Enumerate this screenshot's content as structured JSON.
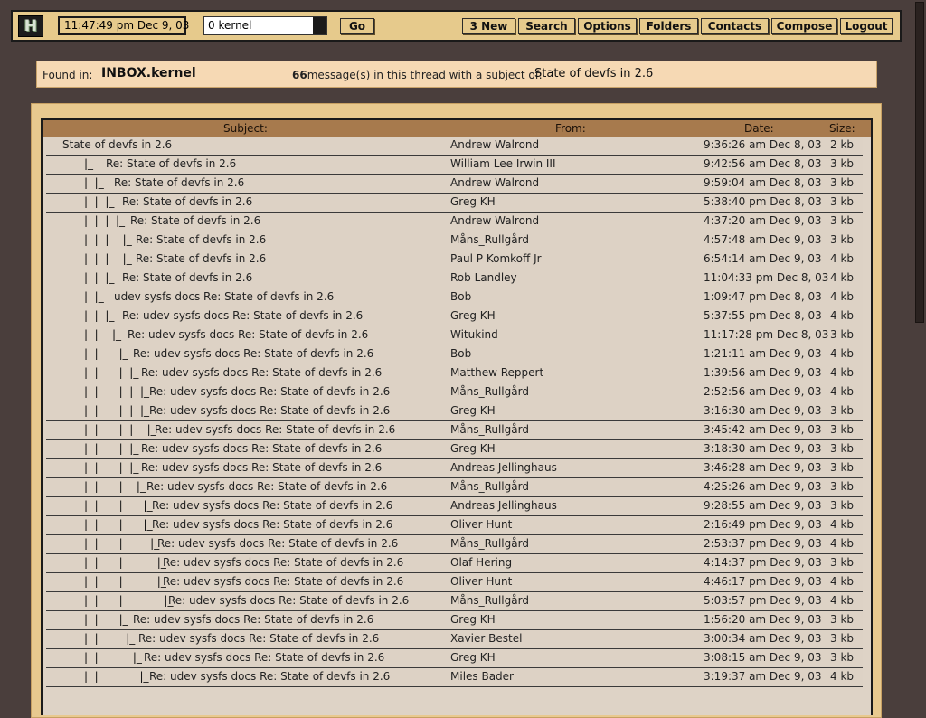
{
  "toolbar": {
    "logo": "H",
    "clock": "11:47:49 pm Dec 9, 03",
    "folder_value": "0 kernel",
    "go_label": "Go",
    "buttons": {
      "new": "3 New",
      "search": "Search",
      "options": "Options",
      "folders": "Folders",
      "contacts": "Contacts",
      "compose": "Compose",
      "logout": "Logout"
    }
  },
  "infobar": {
    "found_label": "Found in:",
    "folder": "INBOX.kernel",
    "count": "66",
    "count_text": "message(s) in this thread with a subject of:",
    "subject": "State of devfs in 2.6"
  },
  "list": {
    "headers": {
      "subject": "Subject:",
      "from": "From:",
      "date": "Date:",
      "size": "Size:"
    },
    "rows": [
      {
        "tree": "",
        "subject": "State of devfs in 2.6",
        "from": "Andrew Walrond",
        "date": "9:36:26 am Dec 8, 03",
        "size": "2 kb"
      },
      {
        "tree": "|_",
        "subject": "Re: State of devfs in 2.6",
        "from": "William Lee Irwin III",
        "date": "9:42:56 am Dec 8, 03",
        "size": "3 kb"
      },
      {
        "tree": "|  |_",
        "subject": "Re: State of devfs in 2.6",
        "from": "Andrew Walrond",
        "date": "9:59:04 am Dec 8, 03",
        "size": "3 kb"
      },
      {
        "tree": "|  |  |_",
        "subject": "Re: State of devfs in 2.6",
        "from": "Greg KH",
        "date": "5:38:40 pm Dec 8, 03",
        "size": "3 kb"
      },
      {
        "tree": "|  |  |  |_",
        "subject": "Re: State of devfs in 2.6",
        "from": "Andrew Walrond",
        "date": "4:37:20 am Dec 9, 03",
        "size": "3 kb"
      },
      {
        "tree": "|  |  |    |_",
        "subject": "Re: State of devfs in 2.6",
        "from": "Måns_Rullgård",
        "date": "4:57:48 am Dec 9, 03",
        "size": "3 kb"
      },
      {
        "tree": "|  |  |    |_",
        "subject": "Re: State of devfs in 2.6",
        "from": "Paul P Komkoff Jr",
        "date": "6:54:14 am Dec 9, 03",
        "size": "4 kb"
      },
      {
        "tree": "|  |  |_",
        "subject": "Re: State of devfs in 2.6",
        "from": "Rob Landley",
        "date": "11:04:33 pm Dec 8, 03",
        "size": "4 kb"
      },
      {
        "tree": "|  |_",
        "subject": "udev sysfs docs Re: State of devfs in 2.6",
        "from": "Bob",
        "date": "1:09:47 pm Dec 8, 03",
        "size": "4 kb"
      },
      {
        "tree": "|  |  |_",
        "subject": "Re: udev sysfs docs Re: State of devfs in 2.6",
        "from": "Greg KH",
        "date": "5:37:55 pm Dec 8, 03",
        "size": "4 kb"
      },
      {
        "tree": "|  |    |_",
        "subject": "Re: udev sysfs docs Re: State of devfs in 2.6",
        "from": "Witukind",
        "date": "11:17:28 pm Dec 8, 03",
        "size": "3 kb"
      },
      {
        "tree": "|  |      |_",
        "subject": "Re: udev sysfs docs Re: State of devfs in 2.6",
        "from": "Bob",
        "date": "1:21:11 am Dec 9, 03",
        "size": "4 kb"
      },
      {
        "tree": "|  |      |  |_",
        "subject": "Re: udev sysfs docs Re: State of devfs in 2.6",
        "from": "Matthew Reppert",
        "date": "1:39:56 am Dec 9, 03",
        "size": "4 kb"
      },
      {
        "tree": "|  |      |  |  |_",
        "subject": "Re: udev sysfs docs Re: State of devfs in 2.6",
        "from": "Måns_Rullgård",
        "date": "2:52:56 am Dec 9, 03",
        "size": "4 kb"
      },
      {
        "tree": "|  |      |  |  |_",
        "subject": "Re: udev sysfs docs Re: State of devfs in 2.6",
        "from": "Greg KH",
        "date": "3:16:30 am Dec 9, 03",
        "size": "3 kb"
      },
      {
        "tree": "|  |      |  |    |_",
        "subject": "Re: udev sysfs docs Re: State of devfs in 2.6",
        "from": "Måns_Rullgård",
        "date": "3:45:42 am Dec 9, 03",
        "size": "3 kb"
      },
      {
        "tree": "|  |      |  |_",
        "subject": "Re: udev sysfs docs Re: State of devfs in 2.6",
        "from": "Greg KH",
        "date": "3:18:30 am Dec 9, 03",
        "size": "3 kb"
      },
      {
        "tree": "|  |      |  |_",
        "subject": "Re: udev sysfs docs Re: State of devfs in 2.6",
        "from": "Andreas Jellinghaus",
        "date": "3:46:28 am Dec 9, 03",
        "size": "3 kb"
      },
      {
        "tree": "|  |      |    |_",
        "subject": "Re: udev sysfs docs Re: State of devfs in 2.6",
        "from": "Måns_Rullgård",
        "date": "4:25:26 am Dec 9, 03",
        "size": "3 kb"
      },
      {
        "tree": "|  |      |      |_",
        "subject": "Re: udev sysfs docs Re: State of devfs in 2.6",
        "from": "Andreas Jellinghaus",
        "date": "9:28:55 am Dec 9, 03",
        "size": "3 kb"
      },
      {
        "tree": "|  |      |      |_",
        "subject": "Re: udev sysfs docs Re: State of devfs in 2.6",
        "from": "Oliver Hunt",
        "date": "2:16:49 pm Dec 9, 03",
        "size": "4 kb"
      },
      {
        "tree": "|  |      |        |_",
        "subject": "Re: udev sysfs docs Re: State of devfs in 2.6",
        "from": "Måns_Rullgård",
        "date": "2:53:37 pm Dec 9, 03",
        "size": "4 kb"
      },
      {
        "tree": "|  |      |          |_",
        "subject": "Re: udev sysfs docs Re: State of devfs in 2.6",
        "from": "Olaf Hering",
        "date": "4:14:37 pm Dec 9, 03",
        "size": "3 kb"
      },
      {
        "tree": "|  |      |          |_",
        "subject": "Re: udev sysfs docs Re: State of devfs in 2.6",
        "from": "Oliver Hunt",
        "date": "4:46:17 pm Dec 9, 03",
        "size": "4 kb"
      },
      {
        "tree": "|  |      |            |_",
        "subject": "Re: udev sysfs docs Re: State of devfs in 2.6",
        "from": "Måns_Rullgård",
        "date": "5:03:57 pm Dec 9, 03",
        "size": "4 kb"
      },
      {
        "tree": "|  |      |_",
        "subject": "Re: udev sysfs docs Re: State of devfs in 2.6",
        "from": "Greg KH",
        "date": "1:56:20 am Dec 9, 03",
        "size": "3 kb"
      },
      {
        "tree": "|  |        |_",
        "subject": "Re: udev sysfs docs Re: State of devfs in 2.6",
        "from": "Xavier Bestel",
        "date": "3:00:34 am Dec 9, 03",
        "size": "3 kb"
      },
      {
        "tree": "|  |          |_",
        "subject": "Re: udev sysfs docs Re: State of devfs in 2.6",
        "from": "Greg KH",
        "date": "3:08:15 am Dec 9, 03",
        "size": "3 kb"
      },
      {
        "tree": "|  |            |_",
        "subject": "Re: udev sysfs docs Re: State of devfs in 2.6",
        "from": "Miles Bader",
        "date": "3:19:37 am Dec 9, 03",
        "size": "4 kb"
      }
    ]
  }
}
